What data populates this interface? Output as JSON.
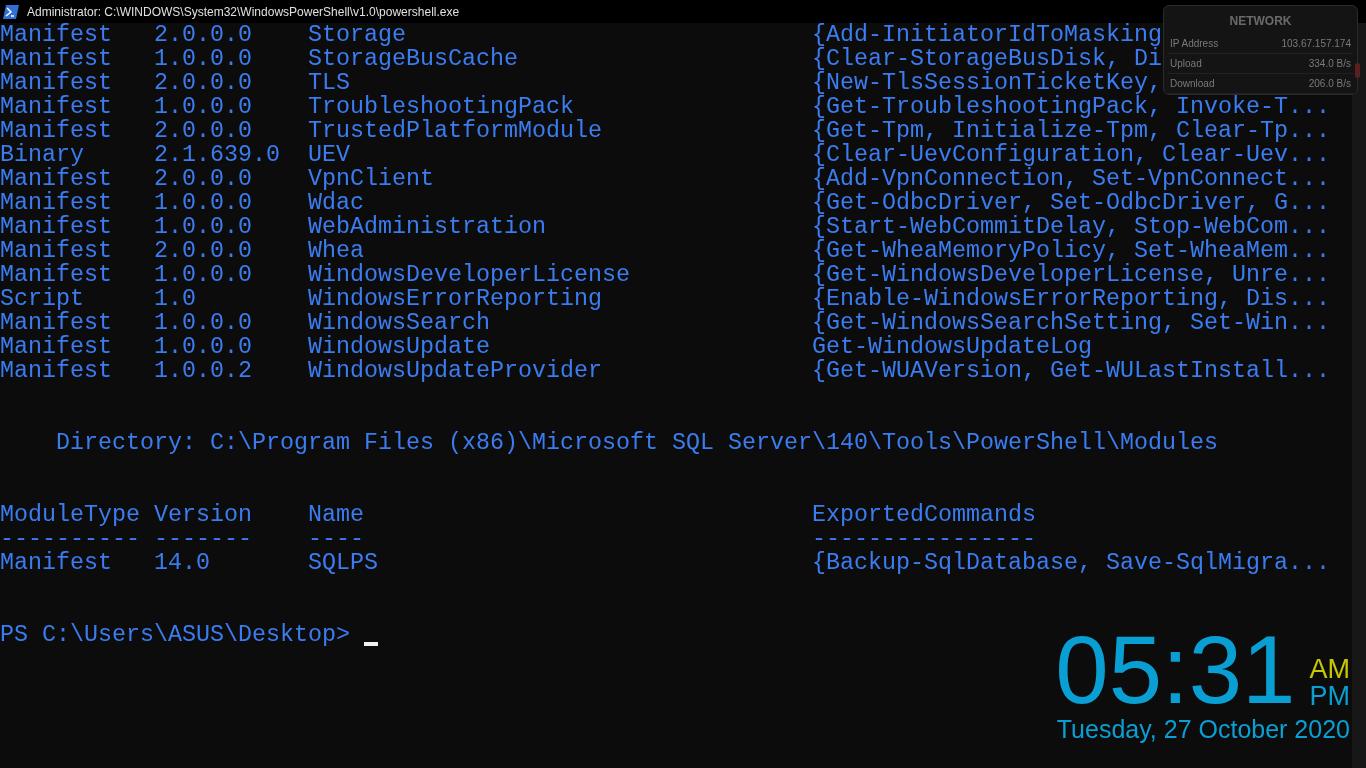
{
  "window": {
    "title": "Administrator: C:\\WINDOWS\\System32\\WindowsPowerShell\\v1.0\\powershell.exe"
  },
  "modules": [
    {
      "module_type": "Manifest",
      "version": "2.0.0.0",
      "name": "Storage",
      "exported_commands": "{Add-InitiatorIdToMasking"
    },
    {
      "module_type": "Manifest",
      "version": "1.0.0.0",
      "name": "StorageBusCache",
      "exported_commands": "{Clear-StorageBusDisk, Di"
    },
    {
      "module_type": "Manifest",
      "version": "2.0.0.0",
      "name": "TLS",
      "exported_commands": "{New-TlsSessionTicketKey,"
    },
    {
      "module_type": "Manifest",
      "version": "1.0.0.0",
      "name": "TroubleshootingPack",
      "exported_commands": "{Get-TroubleshootingPack, Invoke-T..."
    },
    {
      "module_type": "Manifest",
      "version": "2.0.0.0",
      "name": "TrustedPlatformModule",
      "exported_commands": "{Get-Tpm, Initialize-Tpm, Clear-Tp..."
    },
    {
      "module_type": "Binary",
      "version": "2.1.639.0",
      "name": "UEV",
      "exported_commands": "{Clear-UevConfiguration, Clear-Uev..."
    },
    {
      "module_type": "Manifest",
      "version": "2.0.0.0",
      "name": "VpnClient",
      "exported_commands": "{Add-VpnConnection, Set-VpnConnect..."
    },
    {
      "module_type": "Manifest",
      "version": "1.0.0.0",
      "name": "Wdac",
      "exported_commands": "{Get-OdbcDriver, Set-OdbcDriver, G..."
    },
    {
      "module_type": "Manifest",
      "version": "1.0.0.0",
      "name": "WebAdministration",
      "exported_commands": "{Start-WebCommitDelay, Stop-WebCom..."
    },
    {
      "module_type": "Manifest",
      "version": "2.0.0.0",
      "name": "Whea",
      "exported_commands": "{Get-WheaMemoryPolicy, Set-WheaMem..."
    },
    {
      "module_type": "Manifest",
      "version": "1.0.0.0",
      "name": "WindowsDeveloperLicense",
      "exported_commands": "{Get-WindowsDeveloperLicense, Unre..."
    },
    {
      "module_type": "Script",
      "version": "1.0",
      "name": "WindowsErrorReporting",
      "exported_commands": "{Enable-WindowsErrorReporting, Dis..."
    },
    {
      "module_type": "Manifest",
      "version": "1.0.0.0",
      "name": "WindowsSearch",
      "exported_commands": "{Get-WindowsSearchSetting, Set-Win..."
    },
    {
      "module_type": "Manifest",
      "version": "1.0.0.0",
      "name": "WindowsUpdate",
      "exported_commands": "Get-WindowsUpdateLog"
    },
    {
      "module_type": "Manifest",
      "version": "1.0.0.2",
      "name": "WindowsUpdateProvider",
      "exported_commands": "{Get-WUAVersion, Get-WULastInstall..."
    }
  ],
  "directory": {
    "label": "Directory:",
    "path": "C:\\Program Files (x86)\\Microsoft SQL Server\\140\\Tools\\PowerShell\\Modules"
  },
  "table": {
    "columns": [
      "ModuleType",
      "Version",
      "Name",
      "ExportedCommands"
    ],
    "underlines": [
      "----------",
      "-------",
      "----",
      "----------------"
    ],
    "rows": [
      {
        "module_type": "Manifest",
        "version": "14.0",
        "name": "SQLPS",
        "exported_commands": "{Backup-SqlDatabase, Save-SqlMigra..."
      }
    ]
  },
  "prompt": "PS C:\\Users\\ASUS\\Desktop>",
  "network_widget": {
    "title": "NETWORK",
    "rows": [
      {
        "label": "IP Address",
        "value": "103.67.157.174"
      },
      {
        "label": "Upload",
        "value": "334.0 B/s"
      },
      {
        "label": "Download",
        "value": "206.0 B/s"
      }
    ]
  },
  "clock": {
    "time": "05:31",
    "meridiem": [
      {
        "label": "AM",
        "selected": true
      },
      {
        "label": "PM",
        "selected": false
      }
    ],
    "date": "Tuesday, 27 October 2020"
  }
}
